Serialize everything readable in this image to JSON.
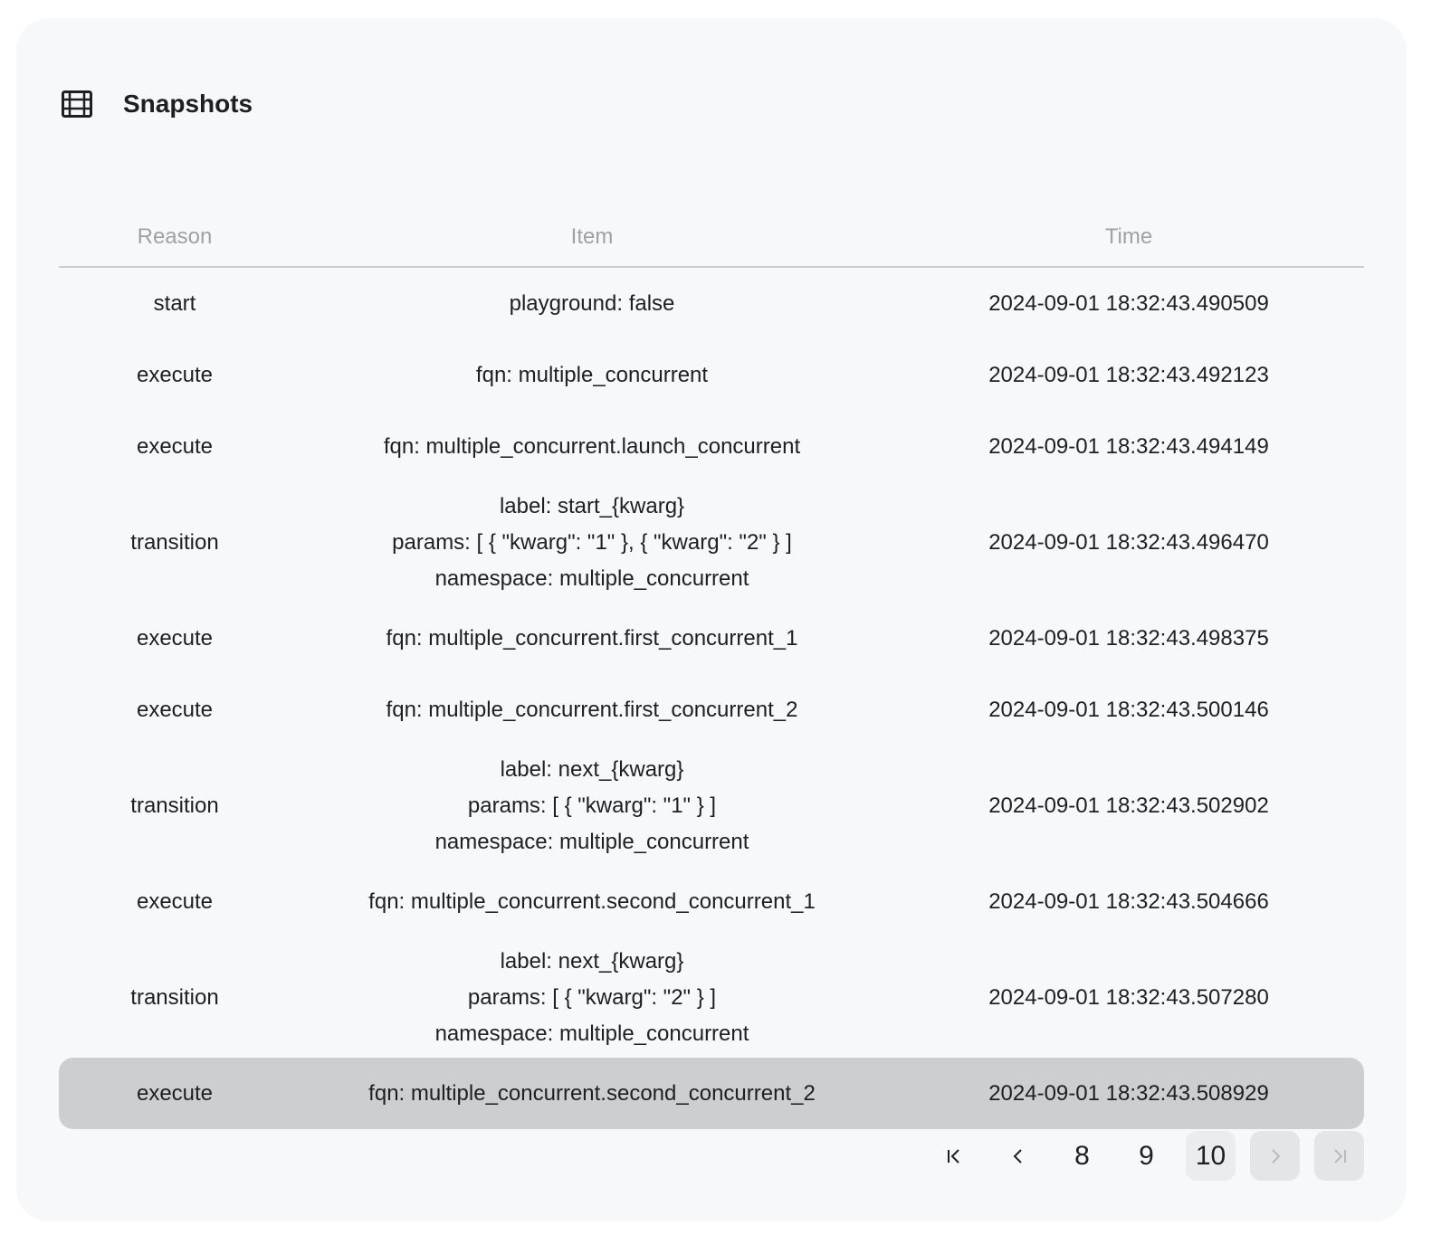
{
  "header": {
    "title": "Snapshots",
    "icon": "film-icon"
  },
  "table": {
    "columns": [
      "Reason",
      "Item",
      "Time"
    ],
    "rows": [
      {
        "reason": "start",
        "item": [
          "playground: false"
        ],
        "time": "2024-09-01 18:32:43.490509"
      },
      {
        "reason": "execute",
        "item": [
          "fqn: multiple_concurrent"
        ],
        "time": "2024-09-01 18:32:43.492123"
      },
      {
        "reason": "execute",
        "item": [
          "fqn: multiple_concurrent.launch_concurrent"
        ],
        "time": "2024-09-01 18:32:43.494149"
      },
      {
        "reason": "transition",
        "item": [
          "label: start_{kwarg}",
          "params: [ { \"kwarg\": \"1\" }, { \"kwarg\": \"2\" } ]",
          "namespace: multiple_concurrent"
        ],
        "time": "2024-09-01 18:32:43.496470"
      },
      {
        "reason": "execute",
        "item": [
          "fqn: multiple_concurrent.first_concurrent_1"
        ],
        "time": "2024-09-01 18:32:43.498375"
      },
      {
        "reason": "execute",
        "item": [
          "fqn: multiple_concurrent.first_concurrent_2"
        ],
        "time": "2024-09-01 18:32:43.500146"
      },
      {
        "reason": "transition",
        "item": [
          "label: next_{kwarg}",
          "params: [ { \"kwarg\": \"1\" } ]",
          "namespace: multiple_concurrent"
        ],
        "time": "2024-09-01 18:32:43.502902"
      },
      {
        "reason": "execute",
        "item": [
          "fqn: multiple_concurrent.second_concurrent_1"
        ],
        "time": "2024-09-01 18:32:43.504666"
      },
      {
        "reason": "transition",
        "item": [
          "label: next_{kwarg}",
          "params: [ { \"kwarg\": \"2\" } ]",
          "namespace: multiple_concurrent"
        ],
        "time": "2024-09-01 18:32:43.507280"
      },
      {
        "reason": "execute",
        "item": [
          "fqn: multiple_concurrent.second_concurrent_2"
        ],
        "time": "2024-09-01 18:32:43.508929",
        "selected": true
      }
    ]
  },
  "pagination": {
    "pages": [
      "8",
      "9",
      "10"
    ],
    "current": "10",
    "first_icon": "first-page-icon",
    "prev_icon": "chevron-left-icon",
    "next_icon": "chevron-right-icon",
    "last_icon": "last-page-icon"
  }
}
